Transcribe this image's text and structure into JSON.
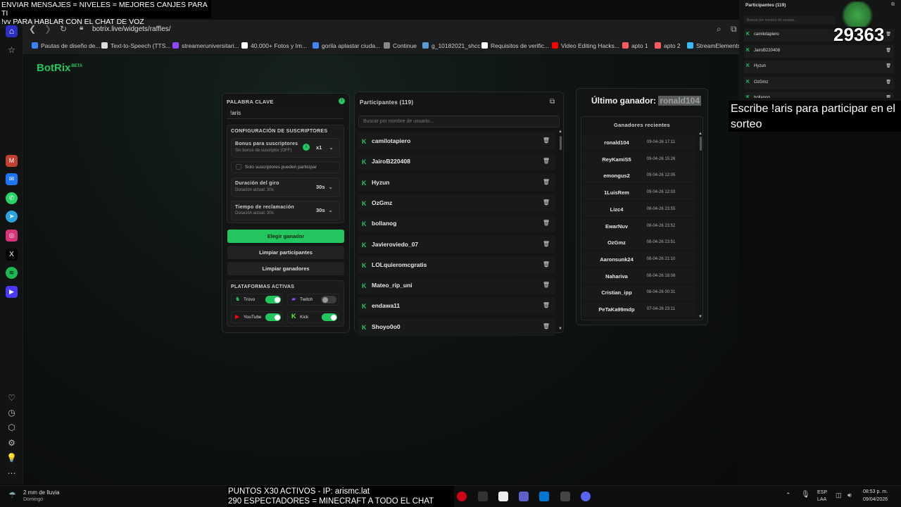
{
  "overlay_top": {
    "line1": "ENVIAR MENSAJES = NIVELES = MEJORES CANJES PARA TI",
    "line2": "!vv PARA HABLAR CON EL CHAT DE VOZ"
  },
  "browser": {
    "url": "botrix.live/widgets/raffles/",
    "bookmarks": [
      "Pautas de diseño de...",
      "Text-to-Speech (TTS...",
      "streameruniversitari...",
      "40.000+ Fotos y Im...",
      "gorila aplastar ciuda...",
      "Continue",
      "g_10182021_shcc",
      "Requisitos de verific...",
      "Video Editing Hacks...",
      "apto 1",
      "apto 2",
      "StreamElements"
    ]
  },
  "app": {
    "logo": "BotRix",
    "logo_badge": "BETA"
  },
  "settings": {
    "keyword_label": "PALABRA CLAVE",
    "keyword_value": "!aris",
    "subs_section": "CONFIGURACIÓN DE SUSCRIPTORES",
    "bonus_label": "Bonus para suscriptores",
    "bonus_sub": "Sin bonus de suscriptor (OFF)",
    "bonus_value": "x1",
    "only_subs": "Solo suscriptores pueden participar",
    "spin_label": "Duración del giro",
    "spin_sub": "Duración actual: 30s",
    "spin_value": "30s",
    "claim_label": "Tiempo de reclamación",
    "claim_sub": "Duración actual: 30s",
    "claim_value": "30s",
    "pick_winner": "Elegir ganador",
    "clear_participants": "Limpiar participantes",
    "clear_winners": "Limpiar ganadores",
    "platforms_label": "PLATAFORMAS ACTIVAS",
    "platforms": [
      {
        "name": "Trovo",
        "enabled": true,
        "color": "#22c55e"
      },
      {
        "name": "Twitch",
        "enabled": false,
        "color": "#9146ff"
      },
      {
        "name": "YouTube",
        "enabled": true,
        "color": "#ff0000"
      },
      {
        "name": "Kick",
        "enabled": true,
        "color": "#53fc18"
      }
    ]
  },
  "participants": {
    "title": "Participantes (119)",
    "search_placeholder": "Buscar por nombre de usuario...",
    "items": [
      "camilotapiero",
      "JairoB220408",
      "Hyzun",
      "OzGmz",
      "bollanog",
      "Javieroviedo_07",
      "LOLquieromcgratis",
      "Mateo_rip_uni",
      "endawa11",
      "Shoyo0o0"
    ]
  },
  "winners": {
    "last_winner_label": "Último ganador:",
    "last_winner": "ronald104",
    "recent_title": "Ganadores recientes",
    "items": [
      {
        "name": "ronald104",
        "date": "09-04-26 17:11"
      },
      {
        "name": "ReyKamiS5",
        "date": "09-04-26 15:26"
      },
      {
        "name": "emongus2",
        "date": "09-04-26 12:05"
      },
      {
        "name": "1LuisRem",
        "date": "09-04-26 12:03"
      },
      {
        "name": "Lizc4",
        "date": "08-04-26 23:55"
      },
      {
        "name": "EwarNuv",
        "date": "08-04-26 23:52"
      },
      {
        "name": "OzGmz",
        "date": "08-04-26 23:51"
      },
      {
        "name": "Aaronsunk24",
        "date": "08-04-26 21:10"
      },
      {
        "name": "Nahariva",
        "date": "08-04-26 18:08"
      },
      {
        "name": "Cristian_ipp",
        "date": "08-04-26 00:31"
      },
      {
        "name": "PeTaKa99mdp",
        "date": "07-04-26 23:11"
      }
    ]
  },
  "stream_overlay": {
    "panel_title": "Participantes (119)",
    "search_placeholder": "Buscar por nombre de usuario...",
    "items": [
      "camilotapiero",
      "JairoB220408",
      "Hyzun",
      "OzGmz",
      "bollanog"
    ],
    "viewer_count": "29363",
    "escribe": "Escribe !aris para participar en el sorteo"
  },
  "taskbar": {
    "weather": "2 mm de lluvia",
    "weather_sub": "Domingo",
    "bottom_line1": "PUNTOS X30 ACTIVOS - IP: arismc.lat",
    "bottom_line2": "290 ESPECTADORES = MINECRAFT A TODO EL CHAT",
    "lang": "ESP",
    "lang_sub": "LAA",
    "time": "08:53 p. m.",
    "date": "09/04/2026"
  },
  "colors": {
    "accent": "#22c55e",
    "bg": "#0b0d0c",
    "panel": "#131514"
  }
}
